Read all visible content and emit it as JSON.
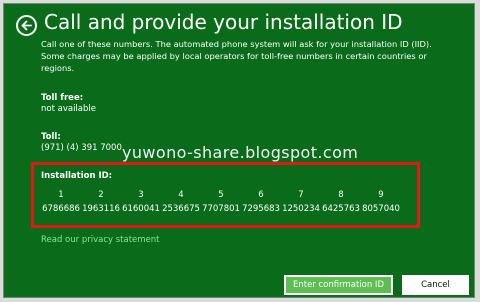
{
  "header": {
    "title": "Call and provide your installation ID"
  },
  "description": "Call one of these numbers. The automated phone system will ask for your installation ID (IID). Some charges may be applied by local operators for toll-free numbers in certain countries or regions.",
  "toll_free": {
    "label": "Toll free:",
    "value": "not available"
  },
  "toll": {
    "label": "Toll:",
    "value": "(971) (4) 391 7000"
  },
  "watermark": "yuwono-share.blogspot.com",
  "installation_id": {
    "label": "Installation ID:",
    "numbers": [
      "1",
      "2",
      "3",
      "4",
      "5",
      "6",
      "7",
      "8",
      "9"
    ],
    "groups": [
      "6786686",
      "1963116",
      "6160041",
      "2536675",
      "7707801",
      "7295683",
      "1250234",
      "6425763",
      "8057040"
    ]
  },
  "privacy_link": "Read our privacy statement",
  "buttons": {
    "enter_confirmation": "Enter confirmation ID",
    "cancel": "Cancel"
  },
  "colors": {
    "background": "#0a6b1a",
    "highlight_border": "#e01818",
    "primary_button": "#5fbe53",
    "link": "#8fe09a"
  },
  "icons": {
    "back": "back-arrow-icon"
  }
}
